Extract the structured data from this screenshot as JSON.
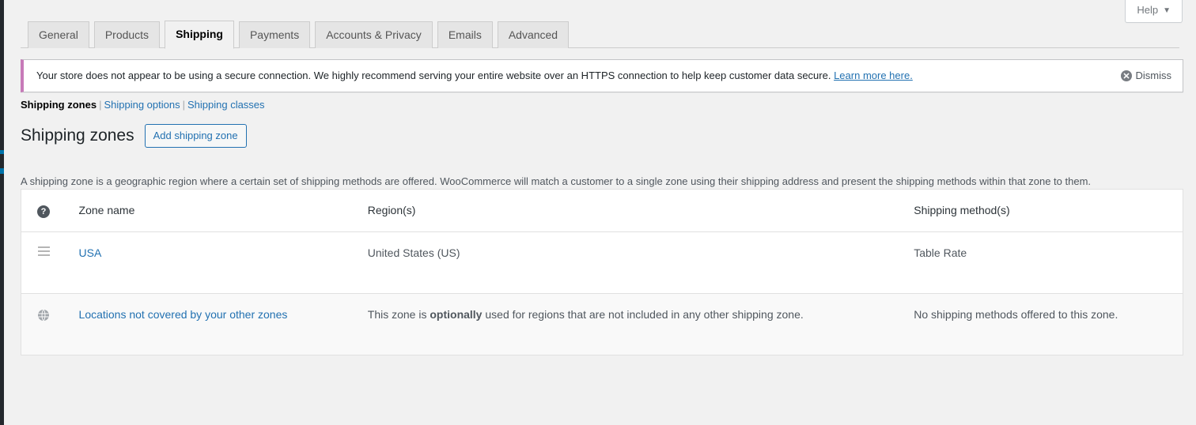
{
  "help": {
    "label": "Help",
    "caret": "chevron-down-icon"
  },
  "tabs": [
    {
      "label": "General",
      "active": false
    },
    {
      "label": "Products",
      "active": false
    },
    {
      "label": "Shipping",
      "active": true
    },
    {
      "label": "Payments",
      "active": false
    },
    {
      "label": "Accounts & Privacy",
      "active": false
    },
    {
      "label": "Emails",
      "active": false
    },
    {
      "label": "Advanced",
      "active": false
    }
  ],
  "notice": {
    "text_before_link": "Your store does not appear to be using a secure connection. We highly recommend serving your entire website over an HTTPS connection to help keep customer data secure. ",
    "link_label": "Learn more here.",
    "dismiss_label": "Dismiss",
    "dismiss_icon": "dismiss-circle-x-icon",
    "accent_color": "#c77ab8"
  },
  "subnav": {
    "items": [
      {
        "label": "Shipping zones",
        "current": true
      },
      {
        "label": "Shipping options",
        "current": false
      },
      {
        "label": "Shipping classes",
        "current": false
      }
    ],
    "separator": "|"
  },
  "heading": {
    "title": "Shipping zones",
    "add_button_label": "Add shipping zone"
  },
  "description": "A shipping zone is a geographic region where a certain set of shipping methods are offered. WooCommerce will match a customer to a single zone using their shipping address and present the shipping methods within that zone to them.",
  "table": {
    "headers": {
      "sort_help_icon": "question-mark-help-icon",
      "sort_help_label": "?",
      "zone_name": "Zone name",
      "regions": "Region(s)",
      "methods": "Shipping method(s)"
    },
    "rows": [
      {
        "icon": "drag-handle-icon",
        "zone_name": "USA",
        "region_text": "United States (US)",
        "region_bold": "",
        "region_text_after": "",
        "methods": "Table Rate",
        "is_worldwide": false
      },
      {
        "icon": "globe-icon",
        "zone_name": "Locations not covered by your other zones",
        "region_text": "This zone is ",
        "region_bold": "optionally",
        "region_text_after": " used for regions that are not included in any other shipping zone.",
        "methods": "No shipping methods offered to this zone.",
        "is_worldwide": true
      }
    ]
  },
  "colors": {
    "link": "#2271b1",
    "page_bg": "#f1f1f1",
    "admin_menu": "#23282d",
    "admin_accent": "#0073aa"
  }
}
